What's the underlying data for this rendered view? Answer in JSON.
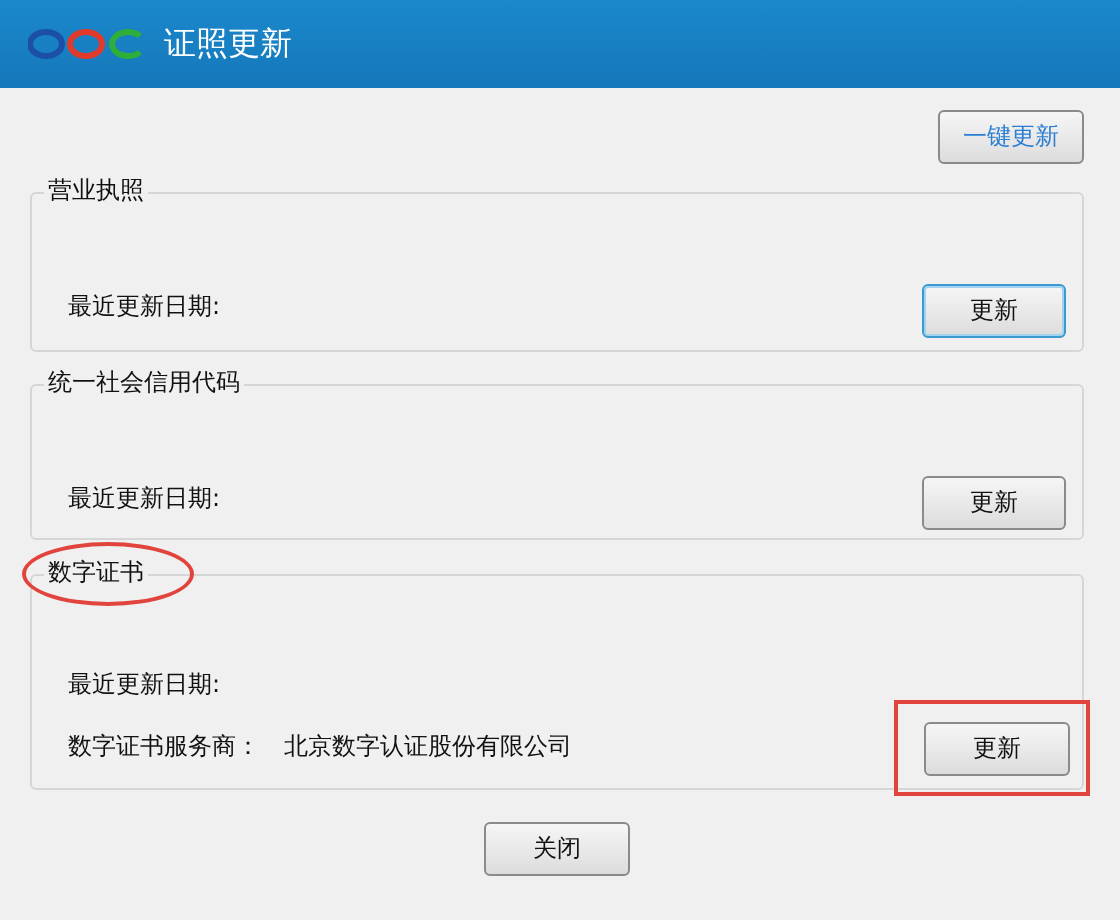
{
  "window": {
    "title": "证照更新"
  },
  "update_all_button": {
    "label": "一键更新"
  },
  "groups": [
    {
      "title": "营业执照",
      "circled": false,
      "rows": [
        {
          "label": "最近更新日期:"
        }
      ],
      "button": {
        "label": "更新",
        "focused": true,
        "boxed": false
      }
    },
    {
      "title": "统一社会信用代码",
      "circled": false,
      "rows": [
        {
          "label": "最近更新日期:"
        }
      ],
      "button": {
        "label": "更新",
        "focused": false,
        "boxed": false
      }
    },
    {
      "title": "数字证书",
      "circled": true,
      "rows": [
        {
          "label": "最近更新日期:"
        },
        {
          "label": "数字证书服务商：",
          "value": "北京数字认证股份有限公司"
        }
      ],
      "button": {
        "label": "更新",
        "focused": false,
        "boxed": true
      }
    }
  ],
  "close_button": {
    "label": "关闭"
  }
}
